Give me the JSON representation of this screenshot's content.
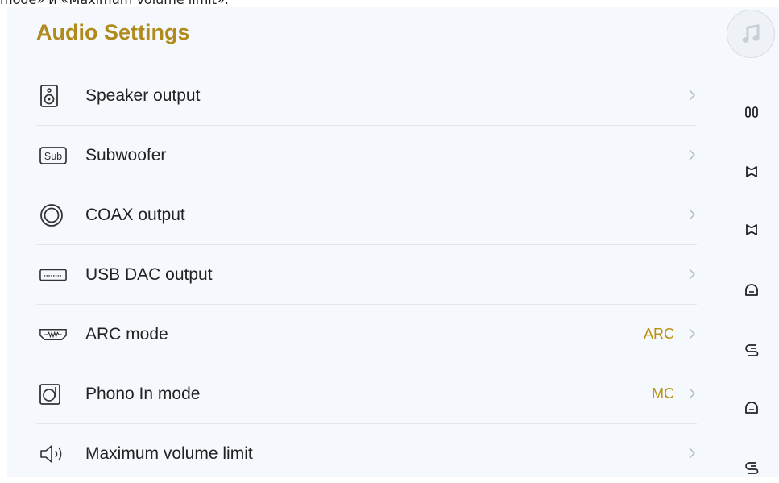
{
  "caption": "mode» и «Maximum volume limit».",
  "page_title": "Audio Settings",
  "header_icon": "music-note-icon",
  "rows": [
    {
      "label": "Speaker output",
      "value": "",
      "icon": "speaker-icon"
    },
    {
      "label": "Subwoofer",
      "value": "",
      "icon": "subwoofer-icon"
    },
    {
      "label": "COAX output",
      "value": "",
      "icon": "coax-icon"
    },
    {
      "label": "USB DAC output",
      "value": "",
      "icon": "usb-icon"
    },
    {
      "label": "ARC mode",
      "value": "ARC",
      "icon": "hdmi-arc-icon"
    },
    {
      "label": "Phono In mode",
      "value": "MC",
      "icon": "turntable-icon"
    },
    {
      "label": "Maximum volume limit",
      "value": "",
      "icon": "volume-icon"
    }
  ],
  "side_icons": [
    "double-bar-icon",
    "bowtie-icon",
    "bowtie-icon",
    "dome-icon",
    "loop-icon",
    "dome-icon",
    "loop-icon"
  ],
  "colors": {
    "accent": "#b18a1e",
    "value": "#b8900e",
    "background": "#f5f9fd",
    "divider": "#e3e7ec"
  }
}
